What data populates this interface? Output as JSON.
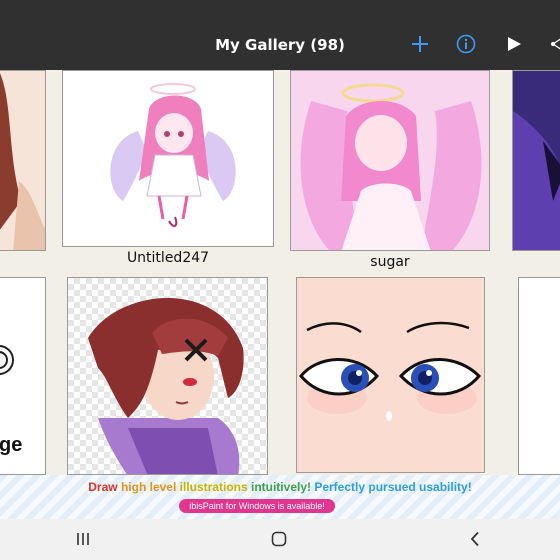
{
  "header": {
    "title": "My Gallery (98)",
    "icons": [
      "plus-icon",
      "info-icon",
      "play-icon",
      "share-icon"
    ],
    "accent_color": "#3d9cf0"
  },
  "gallery": {
    "artworks": [
      {
        "name": ""
      },
      {
        "name": "Untitled247"
      },
      {
        "name": "sugar"
      },
      {
        "name": ""
      },
      {
        "name": ""
      },
      {
        "name": ""
      },
      {
        "name": ""
      },
      {
        "name": ""
      }
    ],
    "partial_text": "ge"
  },
  "ad_banner": {
    "segments": [
      {
        "text": "Draw ",
        "color": "#d9342b"
      },
      {
        "text": "high level ",
        "color": "#e0931a"
      },
      {
        "text": "illustrations ",
        "color": "#c9b400"
      },
      {
        "text": "intuitively! ",
        "color": "#3aa04a"
      },
      {
        "text": "Perfectly pursued usability!",
        "color": "#2d9fd8"
      }
    ],
    "button_text": "ibisPaint for Windows is available!"
  },
  "nav_bar": {
    "icons": [
      "recent-apps-icon",
      "home-icon",
      "back-icon"
    ]
  }
}
